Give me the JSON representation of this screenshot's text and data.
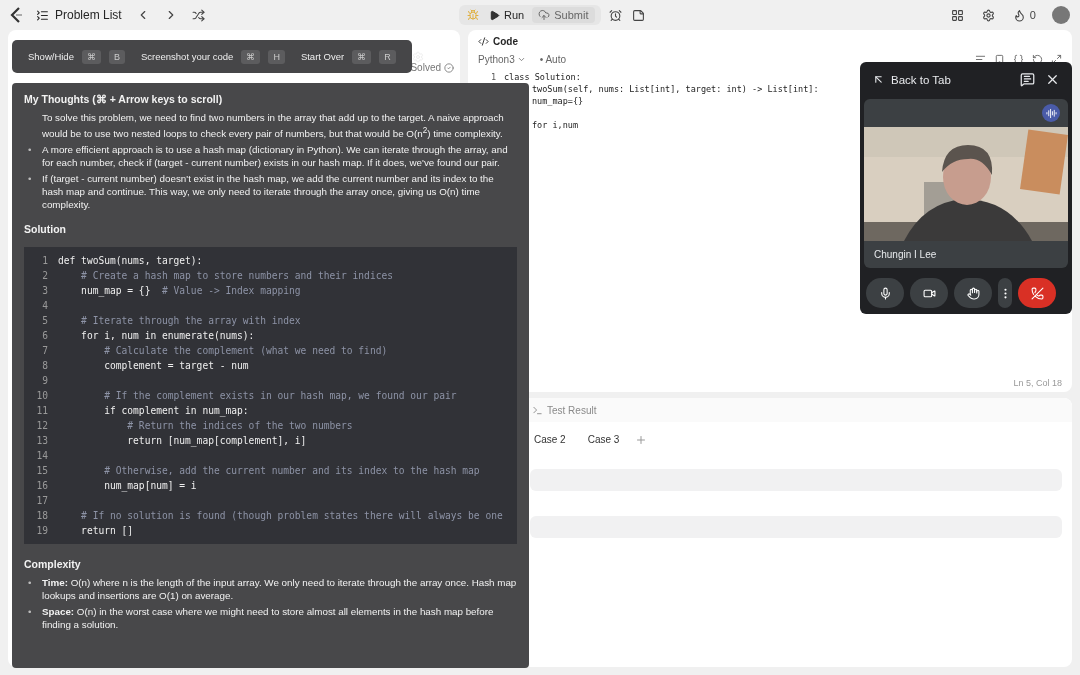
{
  "top_bar": {
    "nav_title": "Problem List",
    "run": "Run",
    "submit": "Submit",
    "streak": "0"
  },
  "description_panel": {
    "status": "Solved"
  },
  "code_panel": {
    "title": "Code",
    "language": "Python3",
    "mode": "• Auto",
    "lines": [
      {
        "number": "1",
        "text": "class Solution:"
      },
      {
        "text": "twoSum(self, nums: List[int], target: int) -> List[int]:"
      },
      {
        "text": "num_map={}"
      },
      {
        "kind": "blank"
      },
      {
        "text": "for i,num"
      }
    ],
    "cursor": "Ln 5, Col 18"
  },
  "testcase_panel": {
    "result_tab": {
      "label": "Test Result",
      "selected": false
    },
    "cases": [
      {
        "label": "Case 2",
        "selected": false
      },
      {
        "label": "Case 3",
        "selected": false
      }
    ],
    "fields": [
      {
        "kind": "input"
      },
      {
        "kind": "input"
      }
    ]
  },
  "assistant_toolbar": {
    "shortcuts": [
      {
        "label": "Show/Hide",
        "keys": [
          "⌘",
          "B"
        ]
      },
      {
        "label": "Screenshot your code",
        "keys": [
          "⌘",
          "H"
        ]
      },
      {
        "label": "Start Over",
        "keys": [
          "⌘",
          "R"
        ]
      }
    ]
  },
  "assistant_panel": {
    "thoughts_title": "My Thoughts (⌘ + Arrow keys to scroll)",
    "thoughts": [
      {
        "text": "To solve this problem, we need to find two numbers in the array that add up to the target. A naive approach would be to use two nested loops to check every pair of numbers, but that would be O(n$^{2}$) time complexity."
      },
      {
        "marker": "•",
        "text": "A more efficient approach is to use a hash map (dictionary in Python). We can iterate through the array, and for each number, check if (target - current number) exists in our hash map. If it does, we've found our pair."
      },
      {
        "marker": "•",
        "text": "If (target - current number) doesn't exist in the hash map, we add the current number and its index to the hash map and continue. This way, we only need to iterate through the array once, giving us O(n) time complexity."
      }
    ],
    "solution_title": "Solution",
    "solution_lines": [
      {
        "number": "1",
        "text": "def twoSum(nums, target):",
        "kind": "code"
      },
      {
        "number": "2",
        "text": "    # Create a hash map to store numbers and their indices",
        "kind": "comment"
      },
      {
        "number": "3",
        "text": "    num_map = {}",
        "kind": "code",
        "comment": "  # Value -> Index mapping"
      },
      {
        "number": "4",
        "kind": "blank"
      },
      {
        "number": "5",
        "text": "    # Iterate through the array with index",
        "kind": "comment"
      },
      {
        "number": "6",
        "text": "    for i, num in enumerate(nums):",
        "kind": "code"
      },
      {
        "number": "7",
        "text": "        # Calculate the complement (what we need to find)",
        "kind": "comment"
      },
      {
        "number": "8",
        "text": "        complement = target - num",
        "kind": "code"
      },
      {
        "number": "9",
        "kind": "blank"
      },
      {
        "number": "10",
        "text": "        # If the complement exists in our hash map, we found our pair",
        "kind": "comment"
      },
      {
        "number": "11",
        "text": "        if complement in num_map:",
        "kind": "code"
      },
      {
        "number": "12",
        "text": "            # Return the indices of the two numbers",
        "kind": "comment"
      },
      {
        "number": "13",
        "text": "            return [num_map[complement], i]",
        "kind": "code"
      },
      {
        "number": "14",
        "kind": "blank"
      },
      {
        "number": "15",
        "text": "        # Otherwise, add the current number and its index to the hash map",
        "kind": "comment"
      },
      {
        "number": "16",
        "text": "        num_map[num] = i",
        "kind": "code"
      },
      {
        "number": "17",
        "kind": "blank"
      },
      {
        "number": "18",
        "text": "    # If no solution is found (though problem states there will always be one",
        "kind": "comment"
      },
      {
        "number": "19",
        "text": "    return []",
        "kind": "code"
      }
    ],
    "complexity_title": "Complexity",
    "complexity": [
      {
        "marker": "•",
        "text": "**Time:** O(n) where n is the length of the input array. We only need to iterate through the array once. Hash map lookups and insertions are O(1) on average."
      },
      {
        "marker": "•",
        "text": "**Space:** O(n) in the worst case where we might need to store almost all elements in the hash map before finding a solution."
      }
    ]
  },
  "video_call": {
    "back": "Back to Tab",
    "participant": "Chungin I Lee"
  }
}
